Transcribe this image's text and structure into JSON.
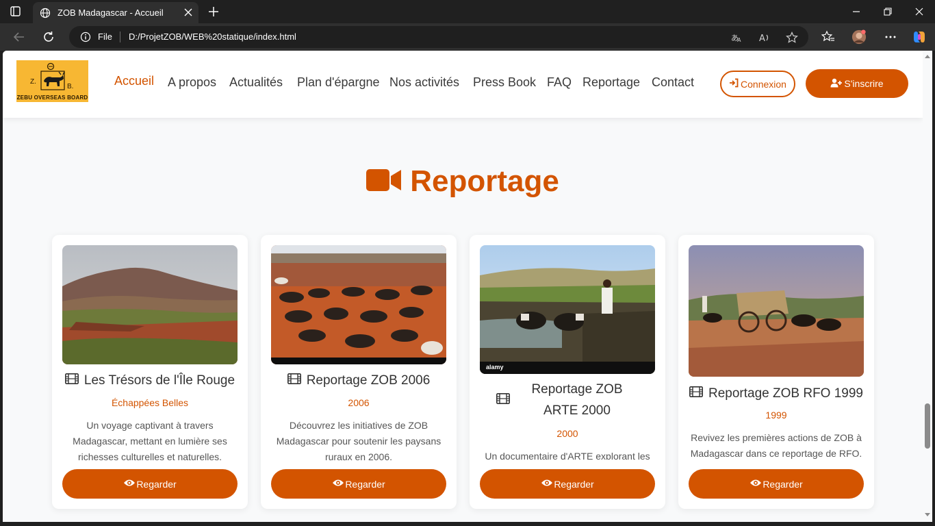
{
  "browser": {
    "tab_title": "ZOB Madagascar - Accueil",
    "omnibox_file_label": "File",
    "url": "D:/ProjetZOB/WEB%20statique/index.html"
  },
  "header": {
    "logo": {
      "letters": [
        "Z.",
        "B."
      ],
      "caption": "ZEBU OVERSEAS BOARD"
    },
    "nav": [
      {
        "label": "Accueil",
        "active": true
      },
      {
        "label": "A propos"
      },
      {
        "label": "Actualités"
      },
      {
        "label": "Plan d'épargne"
      },
      {
        "label": "Nos activités"
      },
      {
        "label": "Press Book"
      },
      {
        "label": "FAQ"
      },
      {
        "label": "Reportage"
      },
      {
        "label": "Contact"
      }
    ],
    "login_label": "Connexion",
    "signup_label": "S'inscrire"
  },
  "section": {
    "title": "Reportage",
    "icon": "video-camera-icon"
  },
  "cards": [
    {
      "title": "Les Trésors de l'Île Rouge",
      "subtitle": "Échappées Belles",
      "description": "Un voyage captivant à travers Madagascar, mettant en lumière ses richesses culturelles et naturelles.",
      "button": "Regarder",
      "image": "landscape-hills-photo"
    },
    {
      "title": "Reportage ZOB 2006",
      "subtitle": "2006",
      "description": "Découvrez les initiatives de ZOB Madagascar pour soutenir les paysans ruraux en 2006.",
      "button": "Regarder",
      "image": "zebu-market-photo"
    },
    {
      "title": "Reportage ZOB ARTE 2000",
      "subtitle": "2000",
      "description": "Un documentaire d'ARTE explorant les",
      "button": "Regarder",
      "image": "zebu-plowing-rice-field-photo",
      "image_watermark": "alamy"
    },
    {
      "title": "Reportage ZOB RFO 1999",
      "subtitle": "1999",
      "description": "Revivez les premières actions de ZOB à Madagascar dans ce reportage de RFO.",
      "button": "Regarder",
      "image": "zebu-cart-photo"
    }
  ],
  "colors": {
    "accent": "#d35400",
    "chrome_bg": "#202020",
    "chrome_toolbar": "#2f2f2f",
    "page_bg": "#f8f9fa",
    "logo_bg": "#f7b733"
  }
}
